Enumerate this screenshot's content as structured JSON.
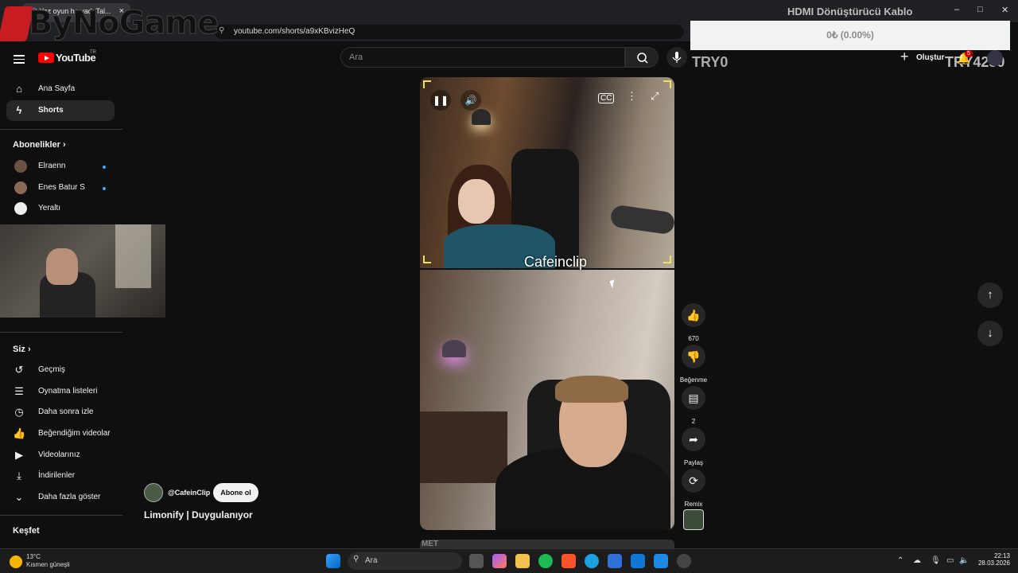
{
  "browser": {
    "tab_title": "(5) Yaz oyun ha yadı Tal...",
    "tab_close": "×",
    "url": "youtube.com/shorts/a9xKBvizHeQ"
  },
  "watermark": {
    "logo_text": "ByNoGame"
  },
  "overlay": {
    "donation_title": "HDMI Dönüştürücü Kablo",
    "donation_progress": "0₺ (0.00%)",
    "donation_fraction": 0,
    "try_left": "TRY0",
    "try_right": "TRY4250"
  },
  "window_controls": {
    "minimize": "–",
    "maximize": "□",
    "close": "✕"
  },
  "header": {
    "logo_text": "YouTube",
    "logo_country": "TR",
    "search_placeholder": "Ara",
    "create_label": "Oluştur",
    "notification_count": "5"
  },
  "sidebar": {
    "nav": [
      {
        "label": "Ana Sayfa",
        "icon": "home-icon"
      },
      {
        "label": "Shorts",
        "icon": "shorts-icon",
        "active": true
      }
    ],
    "subscriptions_title": "Abonelikler",
    "subscriptions": [
      {
        "label": "Elraenn",
        "new": true
      },
      {
        "label": "Enes Batur S",
        "new": true
      },
      {
        "label": "Yeraltı",
        "new": false
      }
    ],
    "you_title": "Siz",
    "you_items": [
      {
        "label": "Geçmiş",
        "icon": "history-icon"
      },
      {
        "label": "Oynatma listeleri",
        "icon": "playlists-icon"
      },
      {
        "label": "Daha sonra izle",
        "icon": "watch-later-icon"
      },
      {
        "label": "Beğendiğim videolar",
        "icon": "liked-videos-icon"
      },
      {
        "label": "Videolarınız",
        "icon": "your-videos-icon"
      },
      {
        "label": "İndirilenler",
        "icon": "downloads-icon"
      },
      {
        "label": "Daha fazla göster",
        "icon": "chevron-down-icon"
      }
    ],
    "explore_title": "Keşfet"
  },
  "video": {
    "caption": "Cafeinclip",
    "channel_handle": "@CafeinClip",
    "subscribe_label": "Abone ol",
    "title": "Limonify | Duygulanıyor",
    "next_strip_text": "MET"
  },
  "actions": {
    "like_count": "670",
    "dislike_label": "Beğenme",
    "comment_count": "2",
    "share_label": "Paylaş",
    "remix_label": "Remix"
  },
  "taskbar": {
    "weather_temp": "13°C",
    "weather_desc": "Kısmen güneşli",
    "search_label": "Ara",
    "time": "22:13",
    "date": "28.03.2026"
  }
}
